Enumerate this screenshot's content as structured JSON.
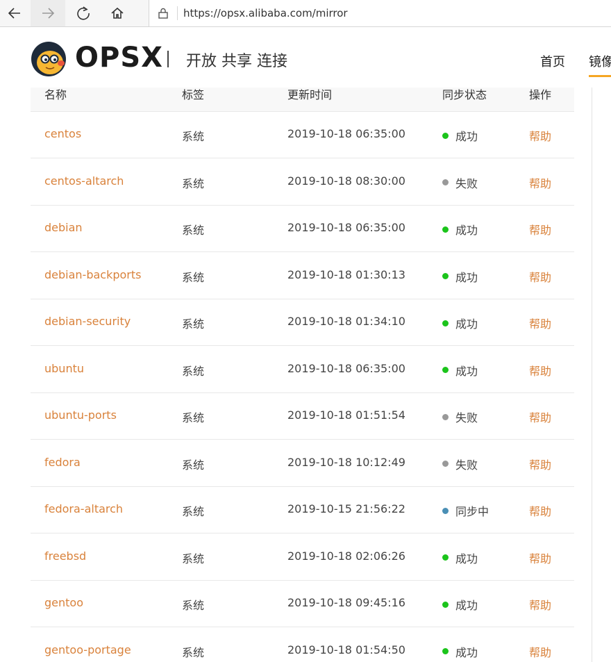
{
  "browser": {
    "url": "https://opsx.alibaba.com/mirror"
  },
  "header": {
    "brand": "OPSX",
    "slogan": "开放 共享 连接",
    "nav": {
      "home": "首页",
      "mirror": "镜像"
    }
  },
  "table": {
    "columns": {
      "name": "名称",
      "tag": "标签",
      "time": "更新时间",
      "status": "同步状态",
      "action": "操作"
    },
    "rows": [
      {
        "name": "centos",
        "tag": "系统",
        "time": "2019-10-18 06:35:00",
        "status": "成功",
        "status_color": "#1bc41b",
        "action": "帮助"
      },
      {
        "name": "centos-altarch",
        "tag": "系统",
        "time": "2019-10-18 08:30:00",
        "status": "失败",
        "status_color": "#999999",
        "action": "帮助"
      },
      {
        "name": "debian",
        "tag": "系统",
        "time": "2019-10-18 06:35:00",
        "status": "成功",
        "status_color": "#1bc41b",
        "action": "帮助"
      },
      {
        "name": "debian-backports",
        "tag": "系统",
        "time": "2019-10-18 01:30:13",
        "status": "成功",
        "status_color": "#1bc41b",
        "action": "帮助"
      },
      {
        "name": "debian-security",
        "tag": "系统",
        "time": "2019-10-18 01:34:10",
        "status": "成功",
        "status_color": "#1bc41b",
        "action": "帮助"
      },
      {
        "name": "ubuntu",
        "tag": "系统",
        "time": "2019-10-18 06:35:00",
        "status": "成功",
        "status_color": "#1bc41b",
        "action": "帮助"
      },
      {
        "name": "ubuntu-ports",
        "tag": "系统",
        "time": "2019-10-18 01:51:54",
        "status": "失败",
        "status_color": "#999999",
        "action": "帮助"
      },
      {
        "name": "fedora",
        "tag": "系统",
        "time": "2019-10-18 10:12:49",
        "status": "失败",
        "status_color": "#999999",
        "action": "帮助"
      },
      {
        "name": "fedora-altarch",
        "tag": "系统",
        "time": "2019-10-15 21:56:22",
        "status": "同步中",
        "status_color": "#4a8fb5",
        "action": "帮助"
      },
      {
        "name": "freebsd",
        "tag": "系统",
        "time": "2019-10-18 02:06:26",
        "status": "成功",
        "status_color": "#1bc41b",
        "action": "帮助"
      },
      {
        "name": "gentoo",
        "tag": "系统",
        "time": "2019-10-18 09:45:16",
        "status": "成功",
        "status_color": "#1bc41b",
        "action": "帮助"
      },
      {
        "name": "gentoo-portage",
        "tag": "系统",
        "time": "2019-10-18 01:54:50",
        "status": "成功",
        "status_color": "#1bc41b",
        "action": "帮助"
      }
    ]
  },
  "colors": {
    "link": "#d9823b",
    "accent": "#f5a623"
  }
}
